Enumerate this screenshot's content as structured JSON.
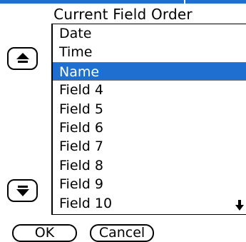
{
  "header": {
    "title": "Current Field Order"
  },
  "fields": [
    {
      "label": "Date",
      "selected": false
    },
    {
      "label": "Time",
      "selected": false
    },
    {
      "label": "Name",
      "selected": true
    },
    {
      "label": "Field 4",
      "selected": false
    },
    {
      "label": "Field 5",
      "selected": false
    },
    {
      "label": "Field 6",
      "selected": false
    },
    {
      "label": "Field 7",
      "selected": false
    },
    {
      "label": "Field 8",
      "selected": false
    },
    {
      "label": "Field 9",
      "selected": false
    },
    {
      "label": "Field 10",
      "selected": false
    }
  ],
  "buttons": {
    "ok_label": "OK",
    "cancel_label": "Cancel",
    "move_up_icon": "up-arrow-icon",
    "move_down_icon": "down-arrow-icon"
  },
  "colors": {
    "accent": "#1f6fd0",
    "selected_text": "#ffffff"
  }
}
